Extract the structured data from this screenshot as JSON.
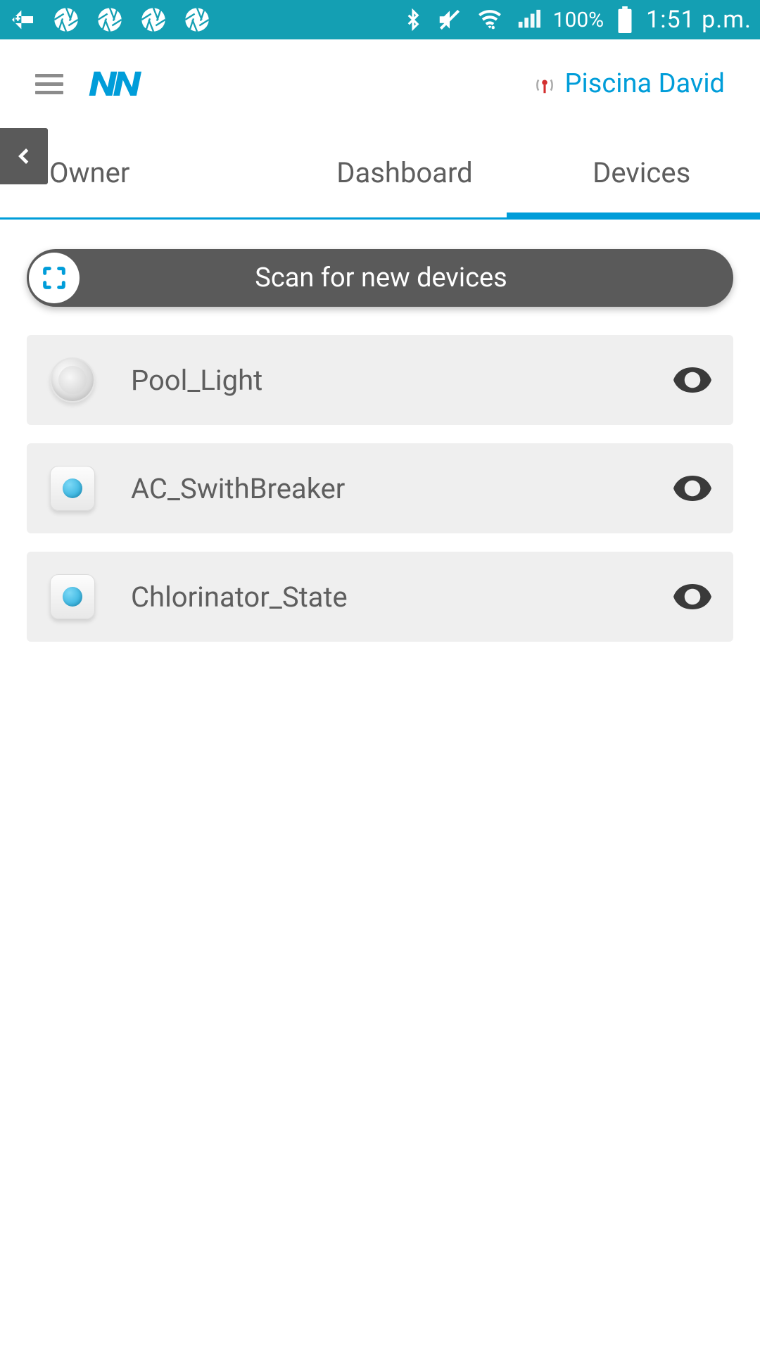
{
  "statusBar": {
    "battery": "100%",
    "time": "1:51 p.m."
  },
  "header": {
    "poolName": "Piscina David"
  },
  "tabs": {
    "owner": "Owner",
    "dashboard": "Dashboard",
    "devices": "Devices",
    "activeIndex": 2
  },
  "scan": {
    "label": "Scan for new devices"
  },
  "devices": [
    {
      "name": "Pool_Light",
      "iconType": "light"
    },
    {
      "name": "AC_SwithBreaker",
      "iconType": "square"
    },
    {
      "name": "Chlorinator_State",
      "iconType": "square"
    }
  ]
}
